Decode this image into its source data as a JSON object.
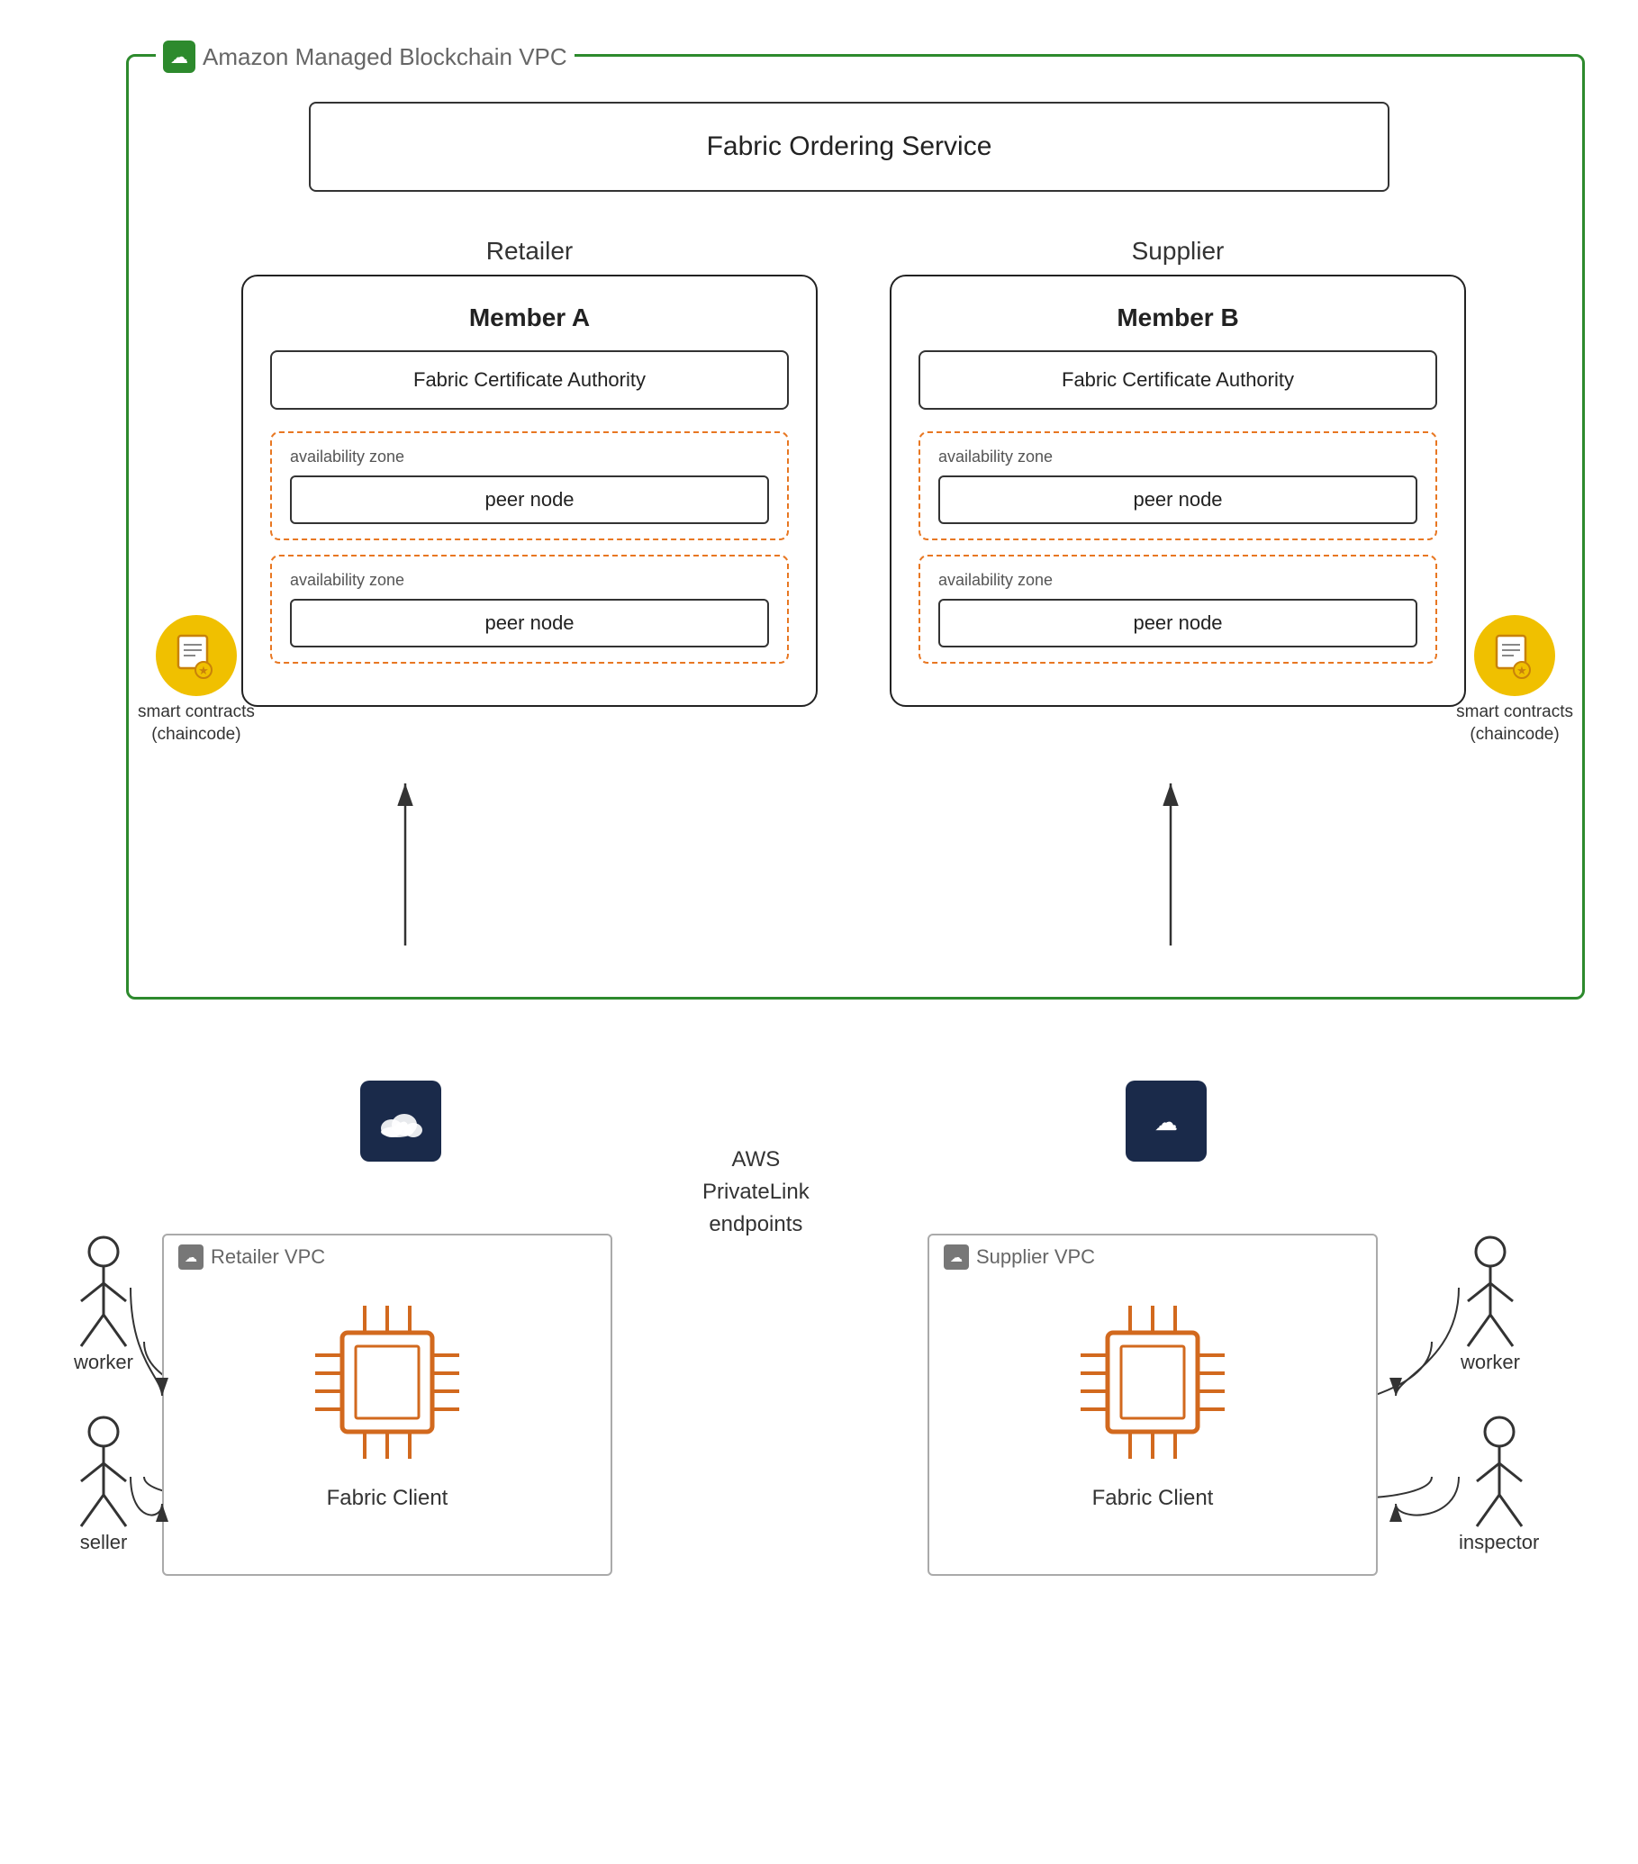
{
  "vpc_outer": {
    "label": "Amazon Managed Blockchain VPC",
    "icon": "☁"
  },
  "ordering_service": {
    "label": "Fabric Ordering Service"
  },
  "retailer": {
    "section_title": "Retailer",
    "member_title": "Member A",
    "cert_authority": "Fabric Certificate Authority",
    "az1_label": "availability zone",
    "az1_peer": "peer node",
    "az2_label": "availability zone",
    "az2_peer": "peer node",
    "smart_contract_label": "smart contracts\n(chaincode)"
  },
  "supplier": {
    "section_title": "Supplier",
    "member_title": "Member B",
    "cert_authority": "Fabric Certificate Authority",
    "az1_label": "availability zone",
    "az1_peer": "peer node",
    "az2_label": "availability zone",
    "az2_peer": "peer node",
    "smart_contract_label": "smart contracts\n(chaincode)"
  },
  "privatelink": {
    "label": "AWS\nPrivateLink\nendpoints",
    "icon": "☁"
  },
  "retailer_vpc": {
    "label": "Retailer VPC",
    "icon": "☁",
    "client_label": "Fabric Client"
  },
  "supplier_vpc": {
    "label": "Supplier VPC",
    "icon": "☁",
    "client_label": "Fabric Client"
  },
  "workers": {
    "left_top": "worker",
    "left_bottom": "seller",
    "right_top": "worker",
    "right_bottom": "inspector"
  }
}
